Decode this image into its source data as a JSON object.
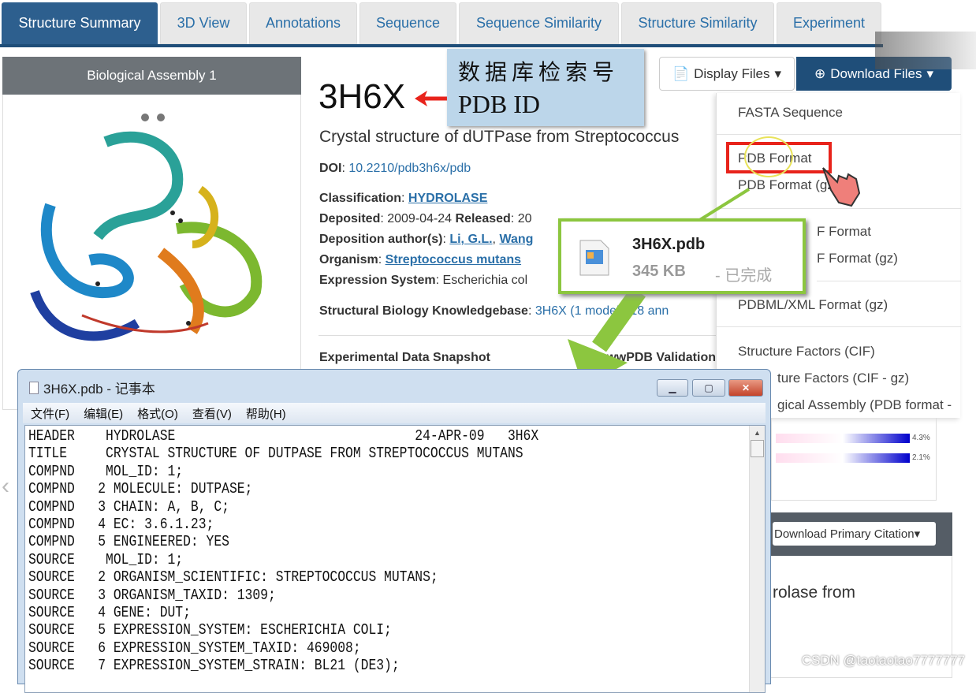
{
  "tabs": [
    {
      "label": "Structure Summary",
      "active": true
    },
    {
      "label": "3D View"
    },
    {
      "label": "Annotations"
    },
    {
      "label": "Sequence"
    },
    {
      "label": "Sequence Similarity"
    },
    {
      "label": "Structure Similarity"
    },
    {
      "label": "Experiment"
    }
  ],
  "assembly": {
    "title": "Biological Assembly 1"
  },
  "entry": {
    "pdb_id": "3H6X",
    "title": "Crystal structure of dUTPase from Streptococcus",
    "doi_label": "DOI",
    "doi": "10.2210/pdb3h6x/pdb",
    "classification_label": "Classification",
    "classification": "HYDROLASE",
    "deposited_label": "Deposited",
    "deposited": "2009-04-24",
    "released_label": "Released",
    "released": "20",
    "authors_label": "Deposition author(s)",
    "authors": [
      "Li, G.L.",
      "Wang"
    ],
    "organism_label": "Organism",
    "organism": "Streptococcus mutans",
    "expression_label": "Expression System",
    "expression": "Escherichia col",
    "sbkb_label": "Structural Biology Knowledgebase",
    "sbkb": "3H6X (1 model >18 ann",
    "snapshot_label": "Experimental Data Snapshot",
    "validation_label": "wwPDB Validation"
  },
  "annotation": {
    "cn": "数据库检索号",
    "en": "PDB ID"
  },
  "buttons": {
    "display_files": "Display Files",
    "download_files": "Download Files",
    "download_citation": "Download Primary Citation"
  },
  "download_menu": [
    "FASTA Sequence",
    "PDB Format",
    "PDB Format (gz)",
    "F Format",
    "F Format (gz)",
    "PDBML/XML Format (gz)",
    "Structure Factors (CIF)",
    "ture Factors (CIF - gz)",
    "gical Assembly (PDB format -"
  ],
  "download_popup": {
    "filename": "3H6X.pdb",
    "size": "345 KB",
    "status": "- 已完成"
  },
  "validation_chart": {
    "labels": [
      "4.3%",
      "2.1%"
    ]
  },
  "citation_text": "rolase from",
  "notepad": {
    "title": "3H6X.pdb - 记事本",
    "menu": [
      "文件(F)",
      "编辑(E)",
      "格式(O)",
      "查看(V)",
      "帮助(H)"
    ],
    "lines": [
      "HEADER    HYDROLASE                               24-APR-09   3H6X",
      "TITLE     CRYSTAL STRUCTURE OF DUTPASE FROM STREPTOCOCCUS MUTANS",
      "COMPND    MOL_ID: 1;",
      "COMPND   2 MOLECULE: DUTPASE;",
      "COMPND   3 CHAIN: A, B, C;",
      "COMPND   4 EC: 3.6.1.23;",
      "COMPND   5 ENGINEERED: YES",
      "SOURCE    MOL_ID: 1;",
      "SOURCE   2 ORGANISM_SCIENTIFIC: STREPTOCOCCUS MUTANS;",
      "SOURCE   3 ORGANISM_TAXID: 1309;",
      "SOURCE   4 GENE: DUT;",
      "SOURCE   5 EXPRESSION_SYSTEM: ESCHERICHIA COLI;",
      "SOURCE   6 EXPRESSION_SYSTEM_TAXID: 469008;",
      "SOURCE   7 EXPRESSION_SYSTEM_STRAIN: BL21 (DE3);"
    ]
  },
  "watermark": "CSDN @taotaotao7777777",
  "colors": {
    "brand": "#1f4e79",
    "link": "#2a6fa8",
    "highlight": "#e8231b",
    "callout": "#8cc63f"
  }
}
